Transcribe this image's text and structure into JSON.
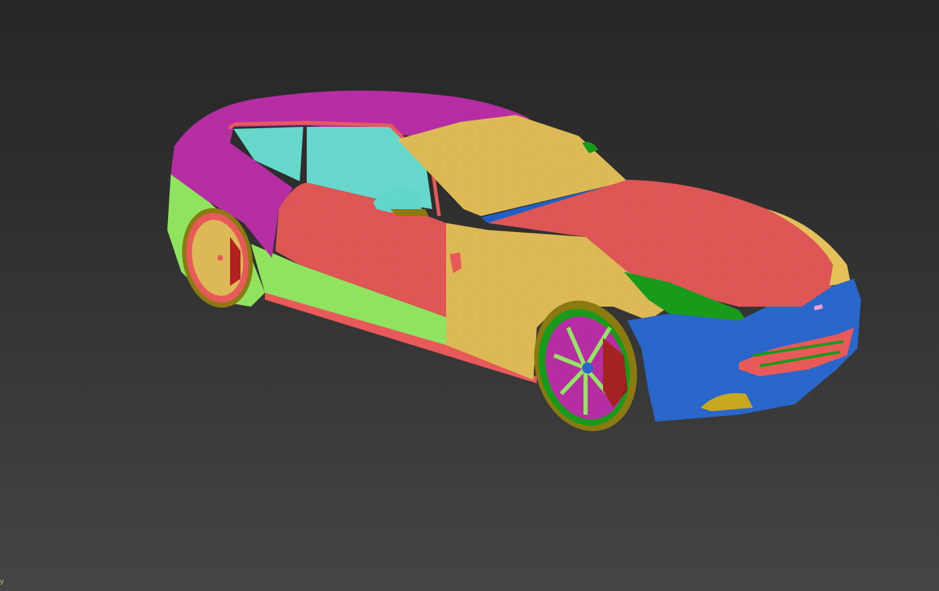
{
  "viewport": {
    "shading_mode": "wireframe-colored-by-object",
    "background_top": "#262626",
    "background_bottom": "#454545"
  },
  "model": {
    "type": "sports car",
    "colors": {
      "roof": "#b2239e",
      "body_red": "#e85a5a",
      "yellow": "#e6c15a",
      "glass": "#5fd6c9",
      "green": "#8fe35e",
      "dark_green": "#1a9a1a",
      "blue": "#1f5fc8",
      "olive": "#8a7a10",
      "magenta_wheel": "#b2239e"
    }
  },
  "gizmo": {
    "axis_label": "y",
    "axis_color": "#d6d64a"
  }
}
